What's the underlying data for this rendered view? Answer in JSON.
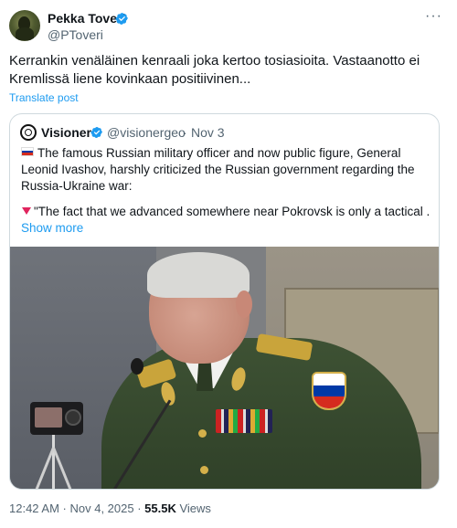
{
  "author": {
    "name": "Pekka Toveri",
    "handle": "@PToveri"
  },
  "post": {
    "text": "Kerrankin venäläinen kenraali joka kertoo tosiasioita. Vastaanotto ei Kremlissä liene kovinkaan positiivinen...",
    "translate_label": "Translate post",
    "timestamp": "12:42 AM · Nov 4, 2025 ·",
    "views_count": "55.5K",
    "views_label": "Views"
  },
  "quote": {
    "name": "Visioner",
    "handle": "@visionergeo",
    "separator": "·",
    "date": "Nov 3",
    "text": "The famous Russian military officer and now public figure, General Leonid Ivashov, harshly criticized the Russian government regarding the Russia-Ukraine war:",
    "text2": "\"The fact that we advanced somewhere near Pokrovsk is only a tactical ...",
    "show_more": "Show more"
  },
  "icons": {
    "verified": "verified-badge-icon",
    "more": "more-options-icon",
    "flag": "russia-flag-icon",
    "triangle": "red-triangle-icon"
  },
  "colors": {
    "accent": "#1d9bf0",
    "secondary_text": "#536471",
    "border": "#cfd9de"
  }
}
